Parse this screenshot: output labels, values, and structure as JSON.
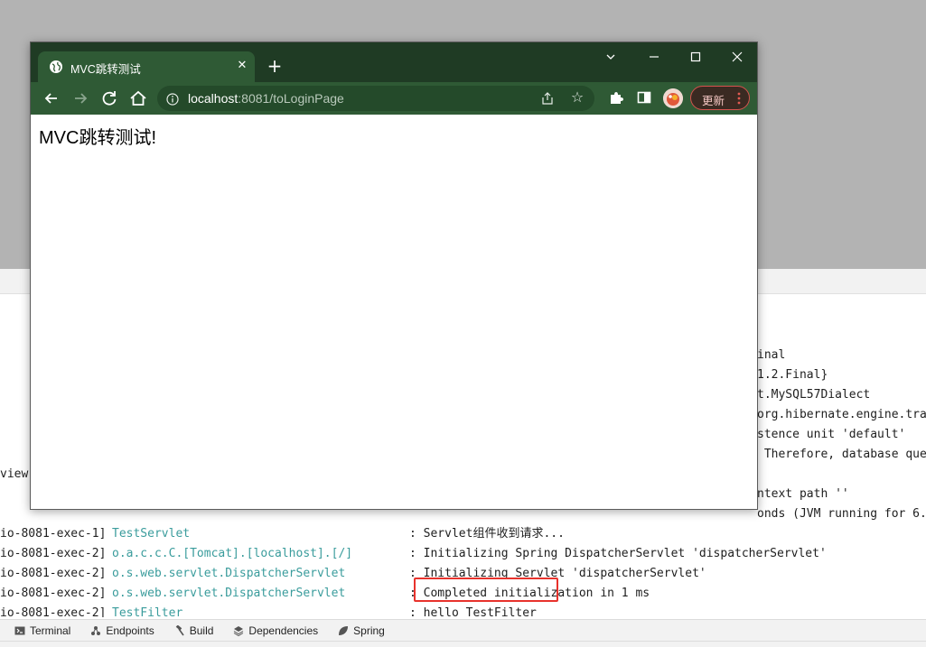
{
  "browser": {
    "tab_title": "MVC跳转测试",
    "url_host": "localhost",
    "url_rest": ":8081/toLoginPage",
    "update_label": "更新",
    "page_heading": "MVC跳转测试!"
  },
  "console": {
    "right_fragments": [
      "inal",
      "1.2.Final}",
      "t.MySQL57Dialect",
      "org.hibernate.engine.tra",
      "stence unit 'default'",
      " Therefore, database que",
      "",
      "ntext path ''",
      "onds (JVM running for 6."
    ],
    "left_fragment": "view",
    "lines": [
      {
        "thread": "io-8081-exec-1]",
        "logger": "TestServlet",
        "message": ": Servlet组件收到请求..."
      },
      {
        "thread": "io-8081-exec-2]",
        "logger": "o.a.c.c.C.[Tomcat].[localhost].[/]",
        "message": ": Initializing Spring DispatcherServlet 'dispatcherServlet'"
      },
      {
        "thread": "io-8081-exec-2]",
        "logger": "o.s.web.servlet.DispatcherServlet",
        "message": ": Initializing Servlet 'dispatcherServlet'"
      },
      {
        "thread": "io-8081-exec-2]",
        "logger": "o.s.web.servlet.DispatcherServlet",
        "message": ": Completed initialization in 1 ms"
      },
      {
        "thread": "io-8081-exec-2]",
        "logger": "TestFilter",
        "message": ": hello TestFilter"
      }
    ]
  },
  "tool_tabs": [
    {
      "label": "Terminal",
      "icon": "terminal-icon"
    },
    {
      "label": "Endpoints",
      "icon": "endpoints-icon"
    },
    {
      "label": "Build",
      "icon": "hammer-icon"
    },
    {
      "label": "Dependencies",
      "icon": "layers-icon"
    },
    {
      "label": "Spring",
      "icon": "leaf-icon"
    }
  ],
  "colors": {
    "logger_teal": "#3a9c9c",
    "highlight_red": "#e8322c",
    "browser_titlebar": "#1f3b24",
    "browser_toolbar": "#2f5a35"
  }
}
